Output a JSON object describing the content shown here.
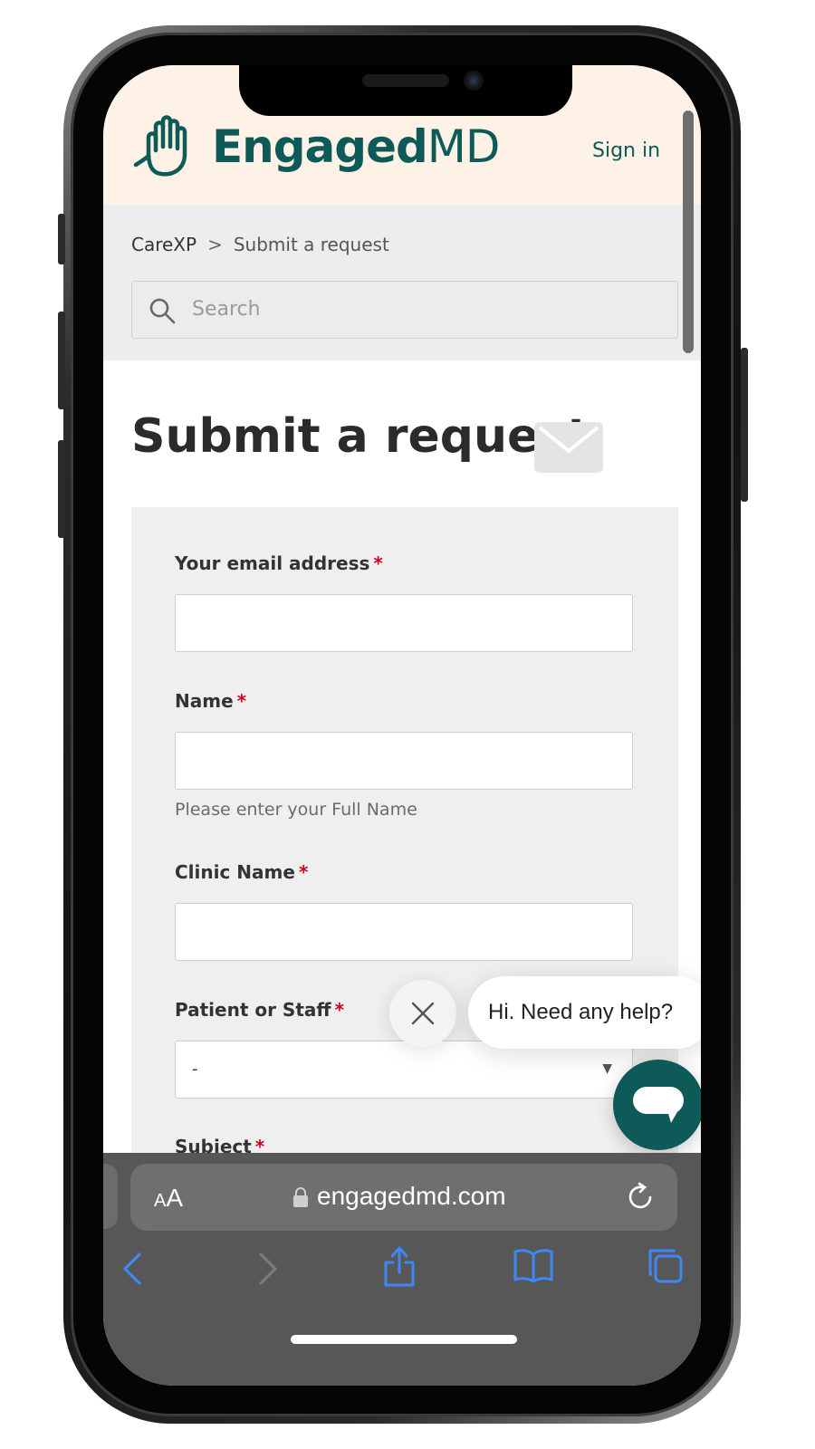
{
  "header": {
    "brand_bold": "Engaged",
    "brand_light": "MD",
    "sign_in": "Sign in"
  },
  "breadcrumb": {
    "root": "CareXP",
    "separator": ">",
    "current": "Submit a request"
  },
  "search": {
    "placeholder": "Search"
  },
  "page": {
    "title": "Submit a request"
  },
  "form": {
    "required_mark": "*",
    "email_label": "Your email address",
    "name_label": "Name",
    "name_hint": "Please enter your Full Name",
    "clinic_label": "Clinic Name",
    "patient_staff_label": "Patient or Staff",
    "patient_staff_value": "-",
    "subject_label": "Subject"
  },
  "chat": {
    "greeting": "Hi. Need any help?"
  },
  "safari": {
    "text_size_small": "A",
    "text_size_big": "A",
    "url": "engagedmd.com"
  },
  "colors": {
    "brand": "#0d5a58",
    "header_bg": "#fdf2e5",
    "required": "#d0021b",
    "ios_blue": "#3f87f5"
  },
  "icons": [
    "hand-logo-icon",
    "search-icon",
    "mail-icon",
    "close-icon",
    "chat-icon",
    "lock-icon",
    "reload-icon",
    "back-icon",
    "forward-icon",
    "share-icon",
    "bookmarks-icon",
    "tabs-icon"
  ]
}
